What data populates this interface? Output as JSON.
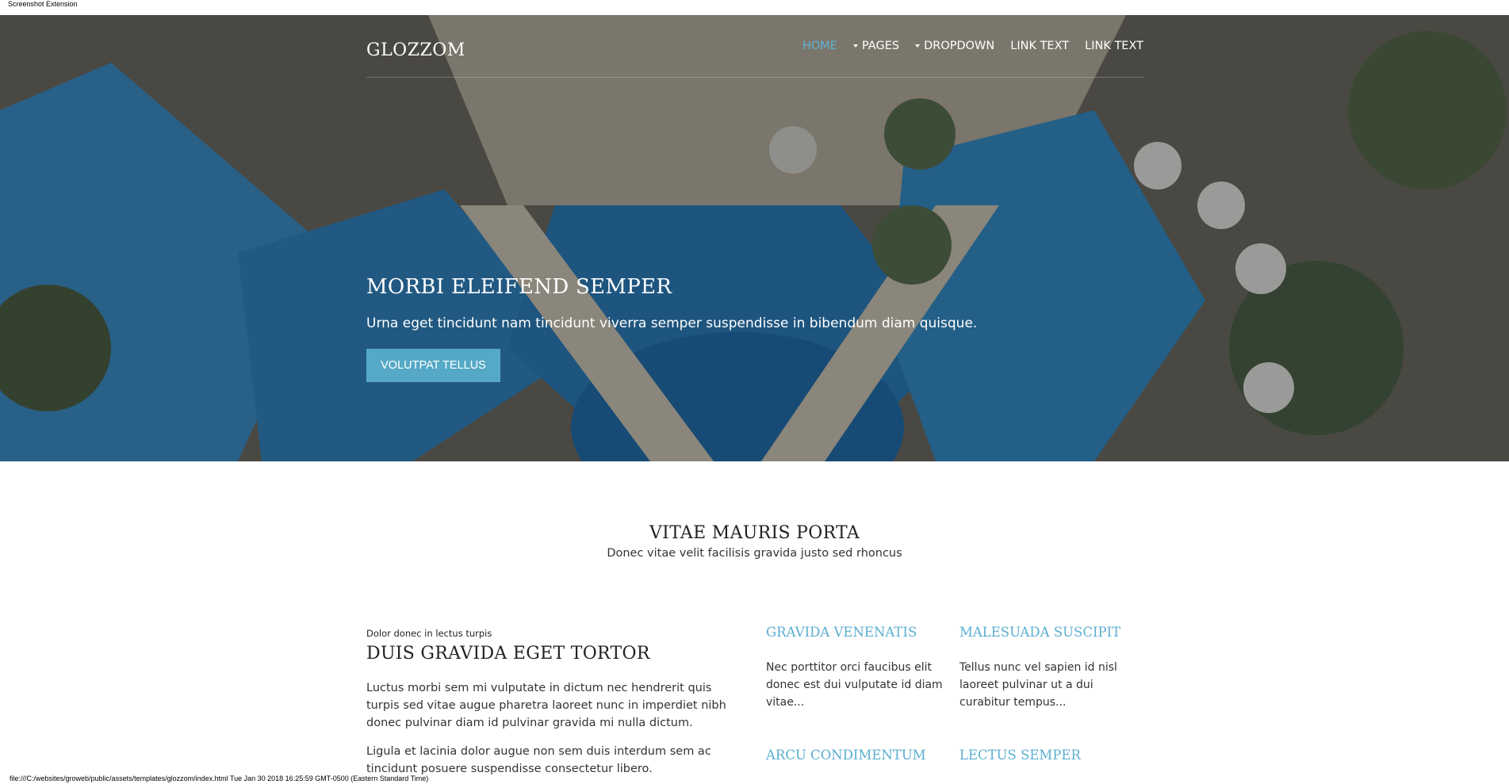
{
  "extension_label": "Screenshot Extension",
  "nav": {
    "brand": "GLOZZOM",
    "items": [
      {
        "label": "HOME"
      },
      {
        "label": "PAGES"
      },
      {
        "label": "DROPDOWN"
      },
      {
        "label": "LINK TEXT"
      },
      {
        "label": "LINK TEXT"
      }
    ]
  },
  "hero": {
    "title": "MORBI ELEIFEND SEMPER",
    "subtitle": "Urna eget tincidunt nam tincidunt viverra semper suspendisse in bibendum diam quisque.",
    "button": "VOLUTPAT TELLUS"
  },
  "section": {
    "title": "VITAE MAURIS PORTA",
    "subtitle": "Donec vitae velit facilisis gravida justo sed rhoncus"
  },
  "article": {
    "kicker": "Dolor donec in lectus turpis",
    "title": "DUIS GRAVIDA EGET TORTOR",
    "paragraphs": [
      "Luctus morbi sem mi vulputate in dictum nec hendrerit quis turpis sed vitae augue pharetra laoreet nunc in imperdiet nibh donec pulvinar diam id pulvinar gravida mi nulla dictum.",
      "Ligula et lacinia dolor augue non sem duis interdum sem ac tincidunt posuere suspendisse consectetur libero."
    ]
  },
  "features": [
    {
      "title": "GRAVIDA VENENATIS",
      "text": "Nec porttitor orci faucibus elit donec est dui vulputate id diam vitae..."
    },
    {
      "title": "MALESUADA SUSCIPIT",
      "text": "Tellus nunc vel sapien id nisl laoreet pulvinar ut a dui curabitur tempus..."
    },
    {
      "title": "ARCU CONDIMENTUM",
      "text": ""
    },
    {
      "title": "LECTUS SEMPER",
      "text": ""
    }
  ],
  "status_bar": "file:///C:/websites/groweb/public/assets/templates/glozzom/index.html Tue Jan 30 2018 16:25:59 GMT-0500 (Eastern Standard Time)",
  "colors": {
    "accent": "#55a9c6",
    "link": "#5aaed0",
    "pool_blue": "#2f7fb8",
    "deck": "#b9ab96"
  }
}
